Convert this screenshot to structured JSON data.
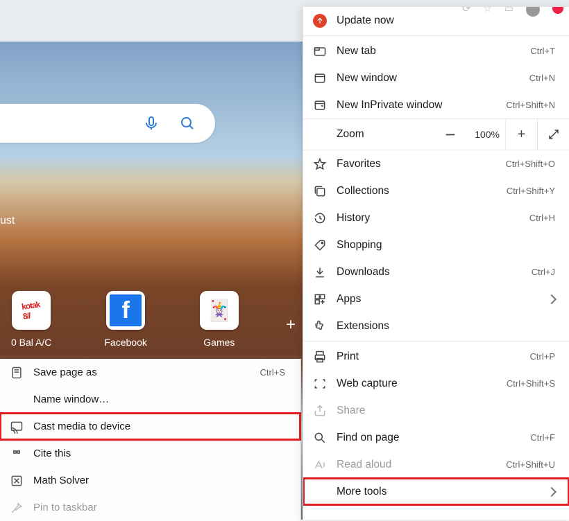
{
  "background": {
    "date_fragment": "ust",
    "tiles": [
      {
        "label": "0 Bal A/C",
        "icon": "kotak"
      },
      {
        "label": "Facebook",
        "icon": "facebook"
      },
      {
        "label": "Games",
        "icon": "cards"
      }
    ]
  },
  "submenu": [
    {
      "name": "save-page-as",
      "icon": "page-icon",
      "label": "Save page as",
      "shortcut": "Ctrl+S",
      "interactable": true
    },
    {
      "name": "name-window",
      "icon": "",
      "label": "Name window…",
      "shortcut": "",
      "interactable": true
    },
    {
      "name": "cast-media",
      "icon": "cast-icon",
      "label": "Cast media to device",
      "shortcut": "",
      "interactable": true,
      "highlight": true
    },
    {
      "name": "cite-this",
      "icon": "quote-icon",
      "label": "Cite this",
      "shortcut": "",
      "interactable": true
    },
    {
      "name": "math-solver",
      "icon": "math-icon",
      "label": "Math Solver",
      "shortcut": "",
      "interactable": true
    },
    {
      "name": "pin-to-taskbar",
      "icon": "pin-icon",
      "label": "Pin to taskbar",
      "shortcut": "",
      "interactable": false,
      "disabled": true
    }
  ],
  "menu": {
    "update_now": "Update now",
    "zoom_label": "Zoom",
    "zoom_value": "100%",
    "items_a": [
      {
        "name": "new-tab",
        "icon": "tab-icon",
        "label": "New tab",
        "shortcut": "Ctrl+T"
      },
      {
        "name": "new-window",
        "icon": "window-icon",
        "label": "New window",
        "shortcut": "Ctrl+N"
      },
      {
        "name": "new-inprivate",
        "icon": "inprivate-icon",
        "label": "New InPrivate window",
        "shortcut": "Ctrl+Shift+N"
      }
    ],
    "items_b": [
      {
        "name": "favorites",
        "icon": "star-icon",
        "label": "Favorites",
        "shortcut": "Ctrl+Shift+O"
      },
      {
        "name": "collections",
        "icon": "collections-icon",
        "label": "Collections",
        "shortcut": "Ctrl+Shift+Y"
      },
      {
        "name": "history",
        "icon": "history-icon",
        "label": "History",
        "shortcut": "Ctrl+H"
      },
      {
        "name": "shopping",
        "icon": "tag-icon",
        "label": "Shopping",
        "shortcut": ""
      },
      {
        "name": "downloads",
        "icon": "download-icon",
        "label": "Downloads",
        "shortcut": "Ctrl+J"
      },
      {
        "name": "apps",
        "icon": "apps-icon",
        "label": "Apps",
        "shortcut": "",
        "chevron": true
      },
      {
        "name": "extensions",
        "icon": "puzzle-icon",
        "label": "Extensions",
        "shortcut": ""
      }
    ],
    "items_c": [
      {
        "name": "print",
        "icon": "print-icon",
        "label": "Print",
        "shortcut": "Ctrl+P"
      },
      {
        "name": "web-capture",
        "icon": "capture-icon",
        "label": "Web capture",
        "shortcut": "Ctrl+Shift+S"
      },
      {
        "name": "share",
        "icon": "share-icon",
        "label": "Share",
        "shortcut": "",
        "disabled": true
      },
      {
        "name": "find-on-page",
        "icon": "find-icon",
        "label": "Find on page",
        "shortcut": "Ctrl+F"
      },
      {
        "name": "read-aloud",
        "icon": "readaloud-icon",
        "label": "Read aloud",
        "shortcut": "Ctrl+Shift+U",
        "disabled": true
      },
      {
        "name": "more-tools",
        "icon": "",
        "label": "More tools",
        "shortcut": "",
        "chevron": true,
        "highlight": true
      }
    ]
  }
}
